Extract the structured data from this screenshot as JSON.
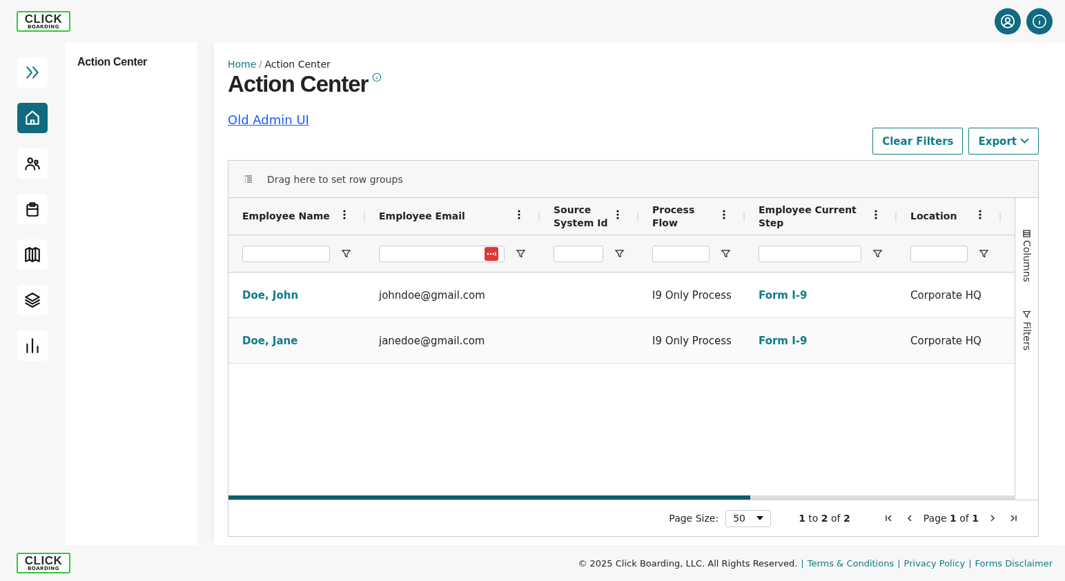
{
  "logo": {
    "word": "CLICK",
    "tagline": "BOARDING"
  },
  "header_buttons": [
    {
      "kind": "profile"
    },
    {
      "kind": "info"
    }
  ],
  "nav_rail": [
    {
      "kind": "expand",
      "selected": false
    },
    {
      "kind": "home",
      "selected": true
    },
    {
      "kind": "people",
      "selected": false
    },
    {
      "kind": "clipboard",
      "selected": false
    },
    {
      "kind": "map",
      "selected": false
    },
    {
      "kind": "layers",
      "selected": false
    },
    {
      "kind": "chart",
      "selected": false
    }
  ],
  "sub_panel": {
    "title": "Action Center"
  },
  "breadcrumb": {
    "home": "Home",
    "separator": "/",
    "current": "Action Center"
  },
  "page_title": "Action Center",
  "old_admin_link": "Old Admin UI",
  "actions": {
    "clear_filters": "Clear Filters",
    "export": "Export"
  },
  "grid": {
    "row_group_hint": "Drag here to set row groups",
    "columns": [
      {
        "label": "Employee Name",
        "password_badge": false
      },
      {
        "label": "Employee Email",
        "password_badge": true
      },
      {
        "label": "Source System Id",
        "password_badge": false
      },
      {
        "label": "Process Flow",
        "password_badge": false
      },
      {
        "label": "Employee Current Step",
        "password_badge": false
      },
      {
        "label": "Location",
        "password_badge": false
      }
    ],
    "rows": [
      {
        "name": "Doe, John",
        "email": "johndoe@gmail.com",
        "flow": "I9 Only Process",
        "step": "Form I-9",
        "location": "Corporate HQ"
      },
      {
        "name": "Doe, Jane",
        "email": "janedoe@gmail.com",
        "flow": "I9 Only Process",
        "step": "Form I-9",
        "location": "Corporate HQ"
      }
    ],
    "side_tabs": [
      "Columns",
      "Filters"
    ],
    "pagination": {
      "page_size_label": "Page Size:",
      "page_size": "50",
      "range": "**1** to **2** of **2**",
      "page": "Page **1** of **1**"
    }
  },
  "footer": {
    "logo": {
      "word": "CLICK",
      "tagline": "BOARDING"
    },
    "copyright": "© 2025 Click Boarding, LLC. All Rights Reserved.",
    "separator": "|",
    "links": [
      "Terms & Conditions",
      "Privacy Policy",
      "Forms Disclaimer"
    ]
  }
}
